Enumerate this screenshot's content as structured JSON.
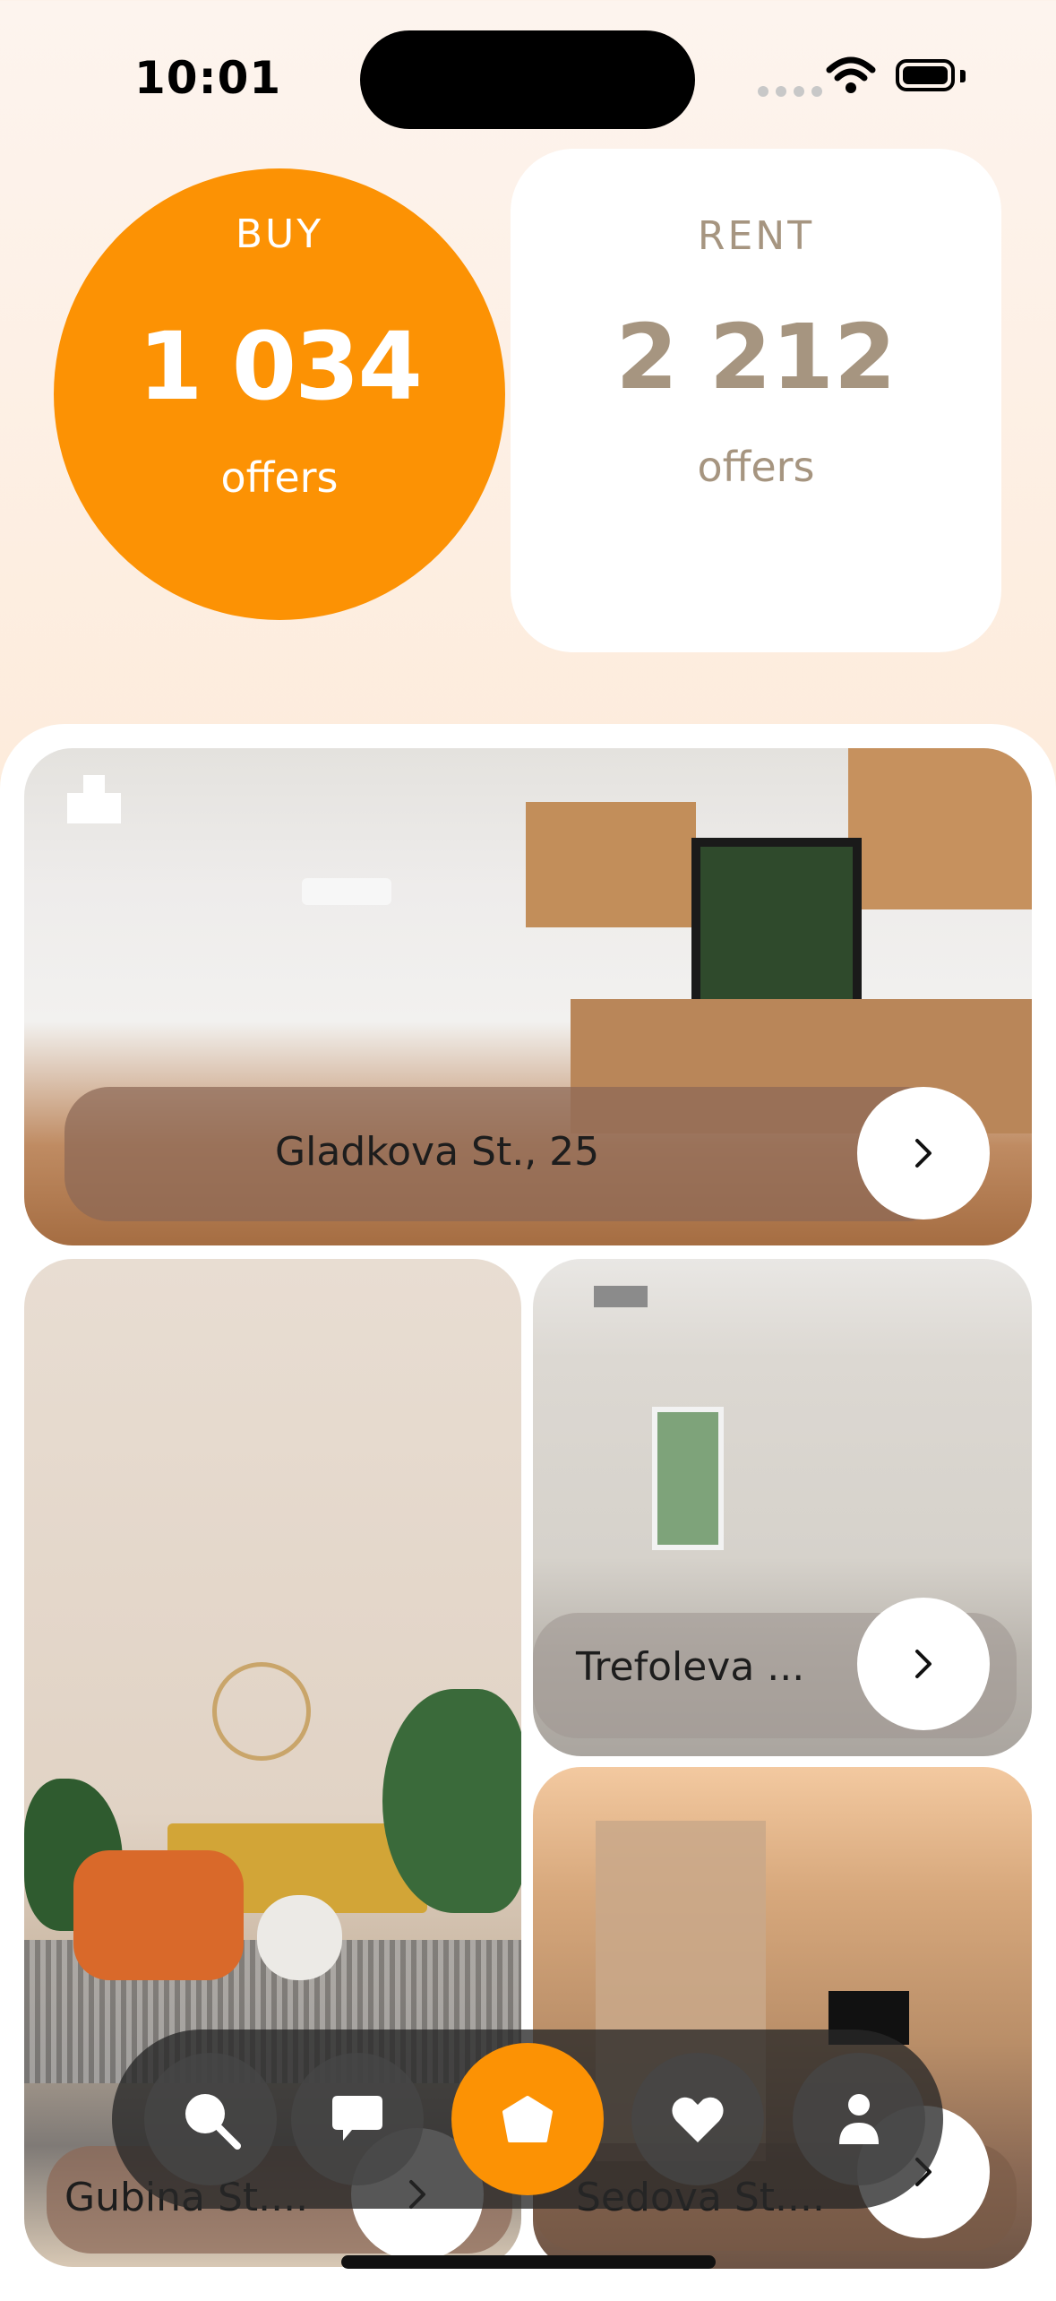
{
  "status_bar": {
    "time": "10:01"
  },
  "stats": {
    "buy": {
      "label": "BUY",
      "count": "1 034",
      "unit": "offers"
    },
    "rent": {
      "label": "RENT",
      "count": "2 212",
      "unit": "offers"
    }
  },
  "listings": [
    {
      "address": "Gladkova St., 25"
    },
    {
      "address": "Gubina St...."
    },
    {
      "address": "Trefoleva ..."
    },
    {
      "address": "Sedova St...."
    }
  ],
  "nav": {
    "items": [
      {
        "icon": "search-icon"
      },
      {
        "icon": "chat-icon"
      },
      {
        "icon": "home-icon",
        "active": true
      },
      {
        "icon": "heart-icon"
      },
      {
        "icon": "profile-icon"
      }
    ]
  },
  "colors": {
    "accent": "#fc9204",
    "rent_text": "#a69580"
  }
}
